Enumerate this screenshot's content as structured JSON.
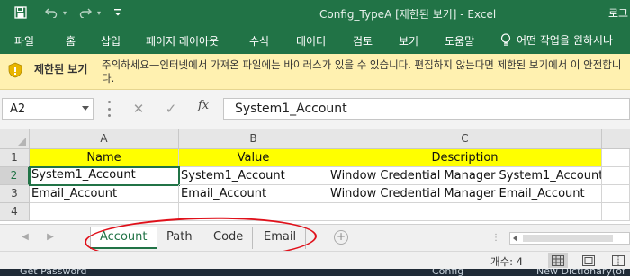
{
  "titlebar": {
    "title": "Config_TypeA  [제한된 보기]  -  Excel",
    "login_label": "로그"
  },
  "ribbon": {
    "tabs": [
      "파일",
      "홈",
      "삽입",
      "페이지 레이아웃",
      "수식",
      "데이터",
      "검토",
      "보기",
      "도움말"
    ],
    "tell_me": "어떤 작업을 원하시나"
  },
  "protected_view": {
    "title": "제한된 보기",
    "message": "주의하세요—인터넷에서 가져온 파일에는 바이러스가 있을 수 있습니다. 편집하지 않는다면 제한된 보기에서 이 안전합니다."
  },
  "formula_bar": {
    "name_box": "A2",
    "fx_label": "fx",
    "formula": "System1_Account"
  },
  "grid": {
    "columns": [
      "A",
      "B",
      "C"
    ],
    "rows": [
      "1",
      "2",
      "3",
      "4"
    ],
    "cells": [
      [
        "Name",
        "Value",
        "Description"
      ],
      [
        "System1_Account",
        "System1_Account",
        "Window Credential Manager System1_Account"
      ],
      [
        "Email_Account",
        "Email_Account",
        "Window Credential Manager Email_Account"
      ],
      [
        "",
        "",
        ""
      ]
    ],
    "header_fill": "#ffff00"
  },
  "sheets": {
    "tabs": [
      "Account",
      "Path",
      "Code",
      "Email"
    ],
    "active": "Account",
    "add_label": "+"
  },
  "status": {
    "count_label": "개수: 4"
  },
  "taskbar": {
    "left": "Get Password",
    "middle": "Config",
    "right": "New Dictionary(of"
  },
  "colors": {
    "excel_green": "#217346",
    "protected_bar": "#fff1b0",
    "annotation": "#e0101a"
  }
}
